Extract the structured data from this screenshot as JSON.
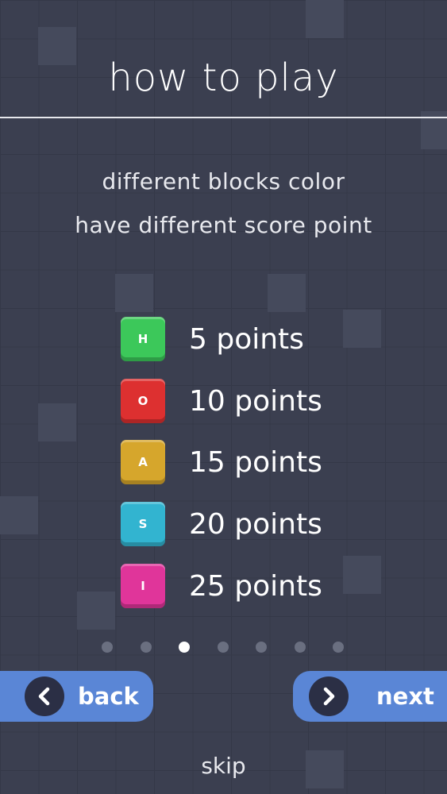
{
  "header": {
    "title": "how to play"
  },
  "description": {
    "line1": "different blocks color",
    "line2": "have different score point"
  },
  "blocks": [
    {
      "letter": "H",
      "points": "5 points",
      "color": "#3cc85a"
    },
    {
      "letter": "O",
      "points": "10 points",
      "color": "#dd3030"
    },
    {
      "letter": "A",
      "points": "15 points",
      "color": "#d6a62c"
    },
    {
      "letter": "S",
      "points": "20 points",
      "color": "#32b4d0"
    },
    {
      "letter": "I",
      "points": "25 points",
      "color": "#e0359a"
    }
  ],
  "pagination": {
    "total": 7,
    "active_index": 3
  },
  "nav": {
    "back_label": "back",
    "next_label": "next",
    "skip_label": "skip",
    "button_color": "#5a86d6"
  }
}
